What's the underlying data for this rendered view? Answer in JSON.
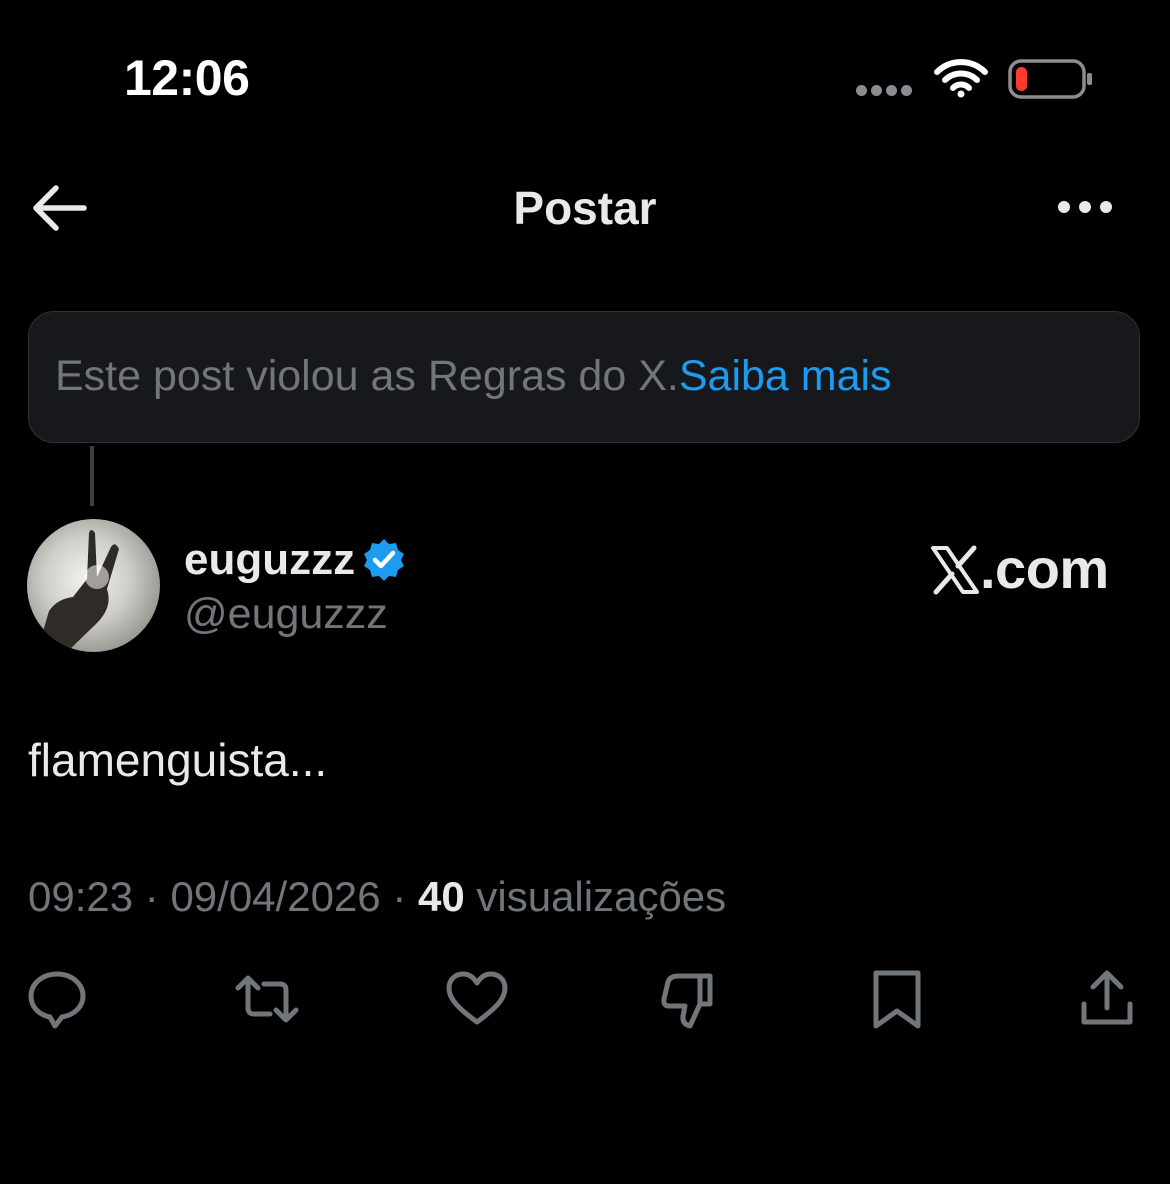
{
  "status_bar": {
    "time": "12:06",
    "signal_icon": "signal-dots-icon",
    "wifi_icon": "wifi-icon",
    "battery_icon": "battery-low-icon",
    "battery_color": "#ff3b30"
  },
  "header": {
    "back_icon": "arrow-left-icon",
    "title": "Postar",
    "more_icon": "more-horizontal-icon"
  },
  "notice": {
    "text": "Este post violou as Regras do X.",
    "link": "Saiba mais"
  },
  "author": {
    "name": "euguzzz",
    "handle": "@euguzzz",
    "verified_icon": "verified-badge-icon",
    "verified_color": "#1d9bf0"
  },
  "watermark": {
    "text": ".com",
    "logo_icon": "x-logo-icon"
  },
  "post": {
    "text": "flamenguista..."
  },
  "meta": {
    "time": "09:23",
    "date": "09/04/2026",
    "views_count": "40",
    "views_label": "visualizações"
  },
  "actions": [
    {
      "name": "reply",
      "icon": "reply-icon"
    },
    {
      "name": "repost",
      "icon": "repost-icon"
    },
    {
      "name": "like",
      "icon": "heart-icon"
    },
    {
      "name": "dislike",
      "icon": "thumbs-down-icon"
    },
    {
      "name": "bookmark",
      "icon": "bookmark-icon"
    },
    {
      "name": "share",
      "icon": "share-icon"
    }
  ],
  "colors": {
    "background": "#000000",
    "primary_text": "#e7e9ea",
    "secondary_text": "#71767b",
    "link": "#1d9bf0",
    "notice_bg": "#16181c"
  }
}
